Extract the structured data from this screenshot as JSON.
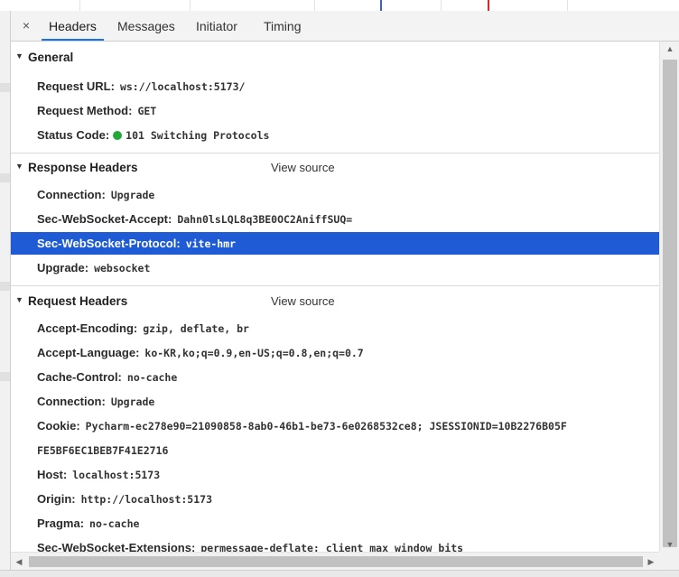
{
  "tabs": {
    "close_glyph": "×",
    "items": [
      {
        "label": "Headers",
        "active": true
      },
      {
        "label": "Messages",
        "active": false
      },
      {
        "label": "Initiator",
        "active": false
      },
      {
        "label": "Timing",
        "active": false
      }
    ]
  },
  "general": {
    "title": "General",
    "request_url": {
      "key": "Request URL:",
      "value": "ws://localhost:5173/"
    },
    "request_method": {
      "key": "Request Method:",
      "value": "GET"
    },
    "status_code": {
      "key": "Status Code:",
      "value": "101 Switching Protocols",
      "dot_color": "#22a83a"
    }
  },
  "response_headers": {
    "title": "Response Headers",
    "view_source": "View source",
    "items": [
      {
        "key": "Connection:",
        "value": "Upgrade"
      },
      {
        "key": "Sec-WebSocket-Accept:",
        "value": "Dahn0lsLQL8q3BE0OC2AniffSUQ="
      },
      {
        "key": "Sec-WebSocket-Protocol:",
        "value": "vite-hmr",
        "selected": true
      },
      {
        "key": "Upgrade:",
        "value": "websocket"
      }
    ]
  },
  "request_headers": {
    "title": "Request Headers",
    "view_source": "View source",
    "items": [
      {
        "key": "Accept-Encoding:",
        "value": "gzip, deflate, br"
      },
      {
        "key": "Accept-Language:",
        "value": "ko-KR,ko;q=0.9,en-US;q=0.8,en;q=0.7"
      },
      {
        "key": "Cache-Control:",
        "value": "no-cache"
      },
      {
        "key": "Connection:",
        "value": "Upgrade"
      },
      {
        "key": "Cookie:",
        "value": "Pycharm-ec278e90=21090858-8ab0-46b1-be73-6e0268532ce8; JSESSIONID=10B2276B05F",
        "continuation": "FE5BF6EC1BEB7F41E2716"
      },
      {
        "key": "Host:",
        "value": "localhost:5173"
      },
      {
        "key": "Origin:",
        "value": "http://localhost:5173"
      },
      {
        "key": "Pragma:",
        "value": "no-cache"
      },
      {
        "key": "Sec-WebSocket-Extensions:",
        "value": "permessage-deflate; client_max_window_bits"
      }
    ]
  },
  "colors": {
    "selection": "#1f5bd5",
    "tab_underline": "#1a73e8",
    "status_ok": "#22a83a"
  },
  "icons": {
    "section_expanded": "triangle-down-icon",
    "scroll_up": "scroll-up-arrow-icon",
    "scroll_down": "scroll-down-arrow-icon",
    "scroll_left": "scroll-left-arrow-icon",
    "scroll_right": "scroll-right-arrow-icon"
  }
}
